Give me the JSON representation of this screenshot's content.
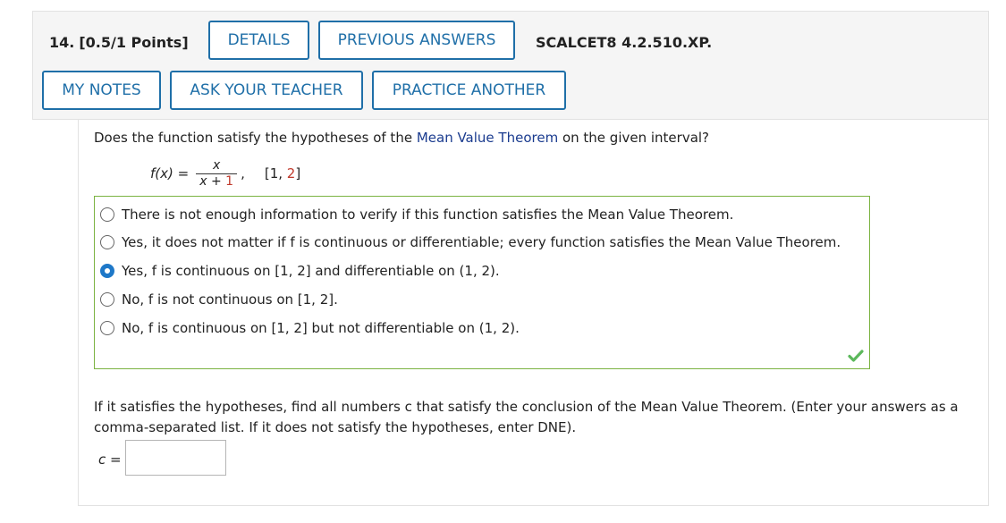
{
  "header": {
    "question_number": "14.",
    "points": "[0.5/1 Points]",
    "buttons": {
      "details": "DETAILS",
      "previous_answers": "PREVIOUS ANSWERS",
      "my_notes": "MY NOTES",
      "ask_teacher": "ASK YOUR TEACHER",
      "practice_another": "PRACTICE ANOTHER"
    },
    "problem_code": "SCALCET8 4.2.510.XP."
  },
  "question": {
    "prompt_before": "Does the function satisfy the hypotheses of the ",
    "prompt_link": "Mean Value Theorem",
    "prompt_after": " on the given interval?",
    "formula": {
      "lhs": "f(x) =",
      "numerator": "x",
      "denominator_var": "x",
      "denominator_op": " + ",
      "denominator_const": "1",
      "comma": ",",
      "interval_open": "[1, ",
      "interval_end": "2",
      "interval_close": "]"
    },
    "choices": [
      {
        "text": "There is not enough information to verify if this function satisfies the Mean Value Theorem.",
        "selected": false
      },
      {
        "text": "Yes, it does not matter if f is continuous or differentiable; every function satisfies the Mean Value Theorem.",
        "selected": false
      },
      {
        "text": "Yes, f is continuous on [1, 2] and differentiable on (1, 2).",
        "selected": true
      },
      {
        "text": "No, f is not continuous on [1, 2].",
        "selected": false
      },
      {
        "text": "No, f is continuous on [1, 2] but not differentiable on (1, 2).",
        "selected": false
      }
    ],
    "correct_icon": "checkmark-icon",
    "correct_color": "#5cb85c"
  },
  "part2": {
    "text": "If it satisfies the hypotheses, find all numbers c that satisfy the conclusion of the Mean Value Theorem. (Enter your answers as a comma-separated list. If it does not satisfy the hypotheses, enter DNE).",
    "input_label_var": "c",
    "input_label_eq": " =",
    "input_value": ""
  },
  "colors": {
    "button_border": "#1f6fa8",
    "selected_radio": "#1e78c8",
    "answer_box_border": "#7cb342",
    "link": "#1b3c8f",
    "red_value": "#c0392b"
  }
}
